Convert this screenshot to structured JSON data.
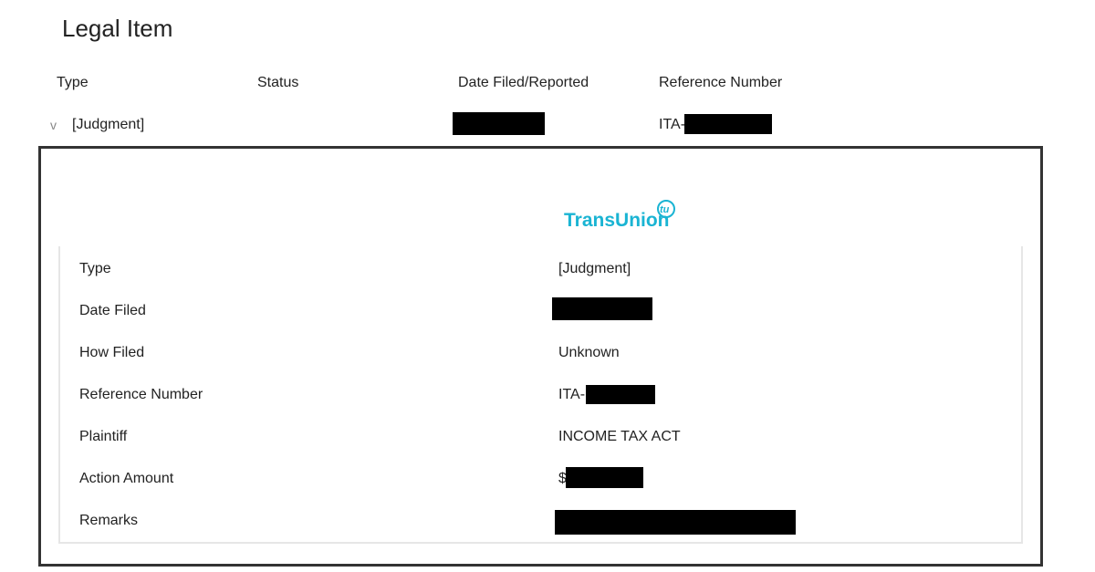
{
  "page_title": "Legal Item",
  "table": {
    "headers": [
      "Type",
      "Status",
      "Date Filed/Reported",
      "Reference Number"
    ],
    "row": {
      "type": "[Judgment]",
      "status": "",
      "reference_prefix": "ITA-"
    },
    "expand_icon": "chevron-down-icon"
  },
  "detail": {
    "logo": "TransUnion",
    "logo_mark": "tu",
    "brand_color": "#1ab4d3",
    "rows": [
      {
        "label": "Type",
        "value": "[Judgment]"
      },
      {
        "label": "Date Filed",
        "value": ""
      },
      {
        "label": "How Filed",
        "value": "Unknown"
      },
      {
        "label": "Reference Number",
        "value": "ITA-"
      },
      {
        "label": "Plaintiff",
        "value": "INCOME TAX ACT"
      },
      {
        "label": "Action Amount",
        "value": "$1"
      },
      {
        "label": "Remarks",
        "value": ""
      }
    ]
  }
}
